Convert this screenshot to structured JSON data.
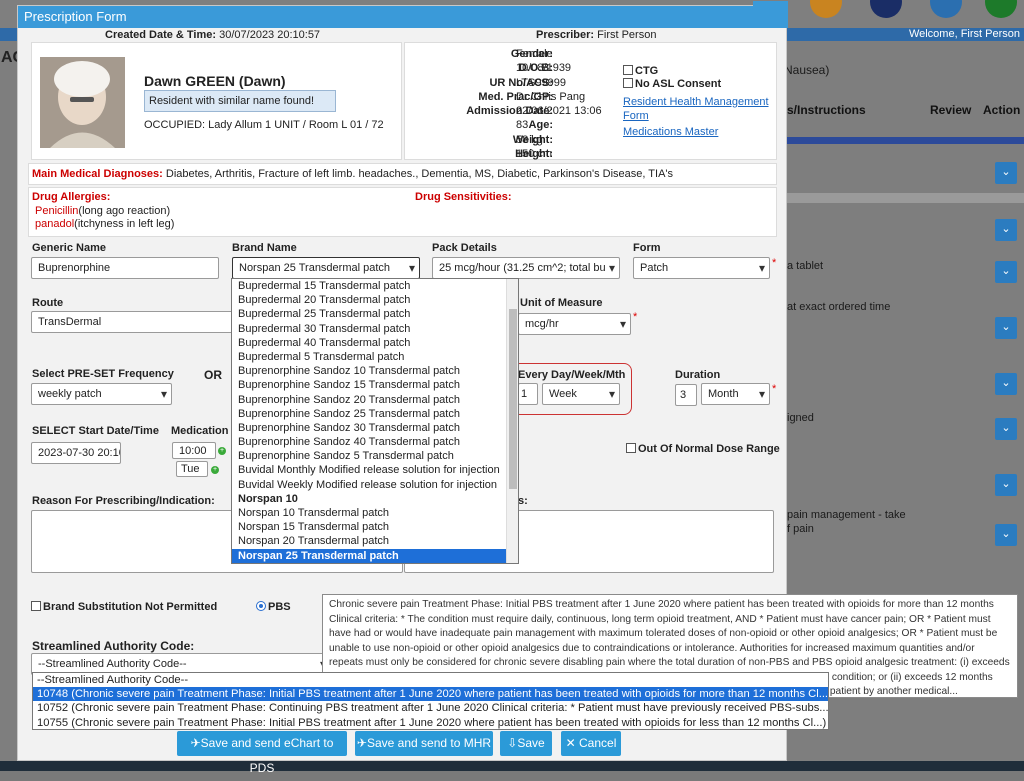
{
  "background": {
    "welcome": "Welcome, First Person",
    "left_fragment": "AC",
    "right_nausea_prefix": "s",
    "right_nausea": "(Nausea)",
    "col_instructions": "s/Instructions",
    "col_review": "Review",
    "col_action": "Action",
    "row_tablet": "a tablet",
    "row_exact": "at exact ordered time",
    "row_signed": "igned",
    "row_pain1": "pain management - take",
    "row_pain2": "f pain"
  },
  "modal": {
    "title": "Prescription Form",
    "created_label": "Created Date & Time:",
    "created_value": "30/07/2023 20:10:57",
    "prescriber_label": "Prescriber:",
    "prescriber_value": "First Person"
  },
  "resident": {
    "name": "Dawn GREEN (Dawn)",
    "similar_notice": "Resident with similar name found!",
    "occupied": "OCCUPIED: Lady Allum 1 UNIT / Room L 01 / 72",
    "gender_label": "Gender:",
    "gender": "Female",
    "dob_label": "D.O.B:",
    "dob": "10/08/1939",
    "ur_label": "UR No/ACS:",
    "ur": "LTS99999",
    "gp_label": "Med. Prac/GP:",
    "gp": "Dr Chris Pang",
    "admission_label": "Admission Date:",
    "admission": "22/06/2021 13:06",
    "age_label": "Age:",
    "age": "83",
    "weight_label": "Weight:",
    "weight": "58 kg",
    "height_label": "Height:",
    "height": "150 cm",
    "ctg": "CTG",
    "no_asl": "No ASL Consent",
    "link_rhm": "Resident Health Management Form",
    "link_meds": "Medications Master"
  },
  "diagnoses": {
    "label": "Main Medical Diagnoses:",
    "value": "Diabetes, Arthritis, Fracture of left limb. headaches., Dementia, MS, Diabetic, Parkinson's Disease, TIA's"
  },
  "allergies": {
    "label": "Drug Allergies:",
    "items": [
      {
        "drug": "Penicillin",
        "note": "(long ago reaction)"
      },
      {
        "drug": "panadol",
        "note": "(itchyness in left leg)"
      }
    ],
    "sensitivities_label": "Drug Sensitivities:"
  },
  "form": {
    "generic_label": "Generic Name",
    "generic_value": "Buprenorphine",
    "brand_label": "Brand Name",
    "brand_value": "Norspan 25 Transdermal patch",
    "pack_label": "Pack Details",
    "pack_value": "25 mcg/hour (31.25 cm^2; total bu",
    "form_label": "Form",
    "form_value": "Patch",
    "route_label": "Route",
    "route_value": "TransDermal",
    "uom_label": "Unit of Measure",
    "uom_value": "mcg/hr",
    "preset_label": "Select PRE-SET Frequency",
    "or": "OR",
    "preset_value": "weekly patch",
    "every_label": "Every Day/Week/Mth",
    "every_num": "1",
    "every_value": "Week",
    "duration_label": "Duration",
    "duration_num": "3",
    "duration_value": "Month",
    "start_label": "SELECT Start Date/Time",
    "start_value": "2023-07-30 20:10",
    "medtime_label": "Medication T",
    "time_value": "10:00",
    "day_value": "Tue",
    "out_of_range": "Out Of Normal Dose Range",
    "reason_label": "Reason For Prescribing/Indication:",
    "notes_label_frag": "s:",
    "brand_sub": "Brand Substitution Not Permitted",
    "pbs": "PBS",
    "streamlined_label": "Streamlined Authority Code:",
    "streamlined_value": "--Streamlined Authority Code--"
  },
  "brand_options": [
    "Bupredermal 15 Transdermal patch",
    "Bupredermal 20 Transdermal patch",
    "Bupredermal 25 Transdermal patch",
    "Bupredermal 30 Transdermal patch",
    "Bupredermal 40 Transdermal patch",
    "Bupredermal 5 Transdermal patch",
    "Buprenorphine Sandoz 10 Transdermal patch",
    "Buprenorphine Sandoz 15 Transdermal patch",
    "Buprenorphine Sandoz 20 Transdermal patch",
    "Buprenorphine Sandoz 25 Transdermal patch",
    "Buprenorphine Sandoz 30 Transdermal patch",
    "Buprenorphine Sandoz 40 Transdermal patch",
    "Buprenorphine Sandoz 5 Transdermal patch",
    "Buvidal Monthly Modified release solution for injection",
    "Buvidal Weekly Modified release solution for injection",
    "Norspan 10",
    "Norspan 10 Transdermal patch",
    "Norspan 15 Transdermal patch",
    "Norspan 20 Transdermal patch",
    "Norspan 25 Transdermal patch"
  ],
  "tooltip": "Chronic severe pain Treatment Phase: Initial PBS treatment after 1 June 2020 where patient has been treated with opioids for more than 12 months Clinical criteria: * The condition must require daily, continuous, long term opioid treatment, AND * Patient must have cancer pain; OR * Patient must have had or would have inadequate pain management with maximum tolerated doses of non-opioid or other opioid analgesics; OR * Patient must be unable to use non-opioid or other opioid analgesics due to contraindications or intolerance. Authorities for increased maximum quantities and/or repeats must only be considered for chronic severe disabling pain where the total duration of non-PBS and PBS opioid analgesic treatment: (i) exceeds 12 months and the palliative care patient is unable to have annual pain management review due to their clinical condition; or (ii) exceeds 12 months and the patient's clinical need for continuing opioid treatment has been confirmed through consultation with the patient by another medical...",
  "authority_options": [
    "--Streamlined Authority Code--",
    "10748 (Chronic severe pain Treatment Phase: Initial PBS treatment after 1 June 2020 where patient has been treated with opioids for more than 12 months Cl...)",
    "10752 (Chronic severe pain Treatment Phase: Continuing PBS treatment after 1 June 2020 Clinical criteria: * Patient must have previously received PBS-subs...)",
    "10755 (Chronic severe pain Treatment Phase: Initial PBS treatment after 1 June 2020 where patient has been treated with opioids for less than 12 months Cl...)"
  ],
  "buttons": {
    "send_pds": "Save and send eChart to PDS",
    "send_mhr": "Save and send to MHR",
    "save": "Save",
    "cancel": "Cancel"
  },
  "colors": {
    "header": "#3a9ad9",
    "button": "#2b9ad8",
    "alert": "#c00000",
    "highlight": "#1e6fd8"
  }
}
